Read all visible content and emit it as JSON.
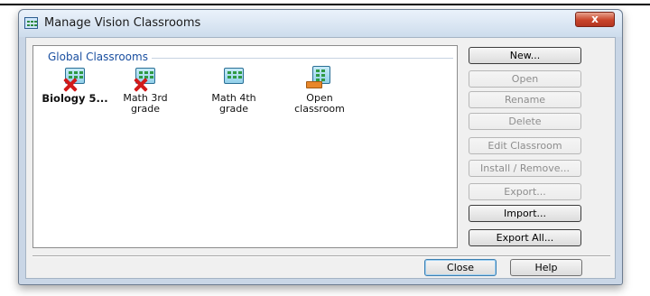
{
  "window": {
    "title": "Manage Vision Classrooms",
    "close_glyph": "x"
  },
  "group": {
    "title": "Global Classrooms",
    "items": [
      {
        "label": "Biology 5...",
        "icon": "classroom-grid-icon",
        "status": "missing-red-x",
        "bold": true
      },
      {
        "label": "Math 3rd grade",
        "icon": "classroom-grid-icon",
        "status": "missing-red-x",
        "bold": false
      },
      {
        "label": "Math 4th grade",
        "icon": "classroom-grid-icon",
        "status": "normal",
        "bold": false
      },
      {
        "label": "Open classroom",
        "icon": "open-classroom-icon",
        "status": "open",
        "bold": false
      }
    ]
  },
  "buttons": {
    "new": "New...",
    "open": "Open",
    "rename": "Rename",
    "delete": "Delete",
    "edit_classroom": "Edit Classroom",
    "install_remove": "Install / Remove...",
    "export": "Export...",
    "import": "Import...",
    "export_all": "Export All..."
  },
  "footer": {
    "close": "Close",
    "help": "Help"
  },
  "colors": {
    "group_title": "#1a4fa0",
    "close_button": "#c9452b",
    "disabled_text": "#8d8d8d"
  }
}
